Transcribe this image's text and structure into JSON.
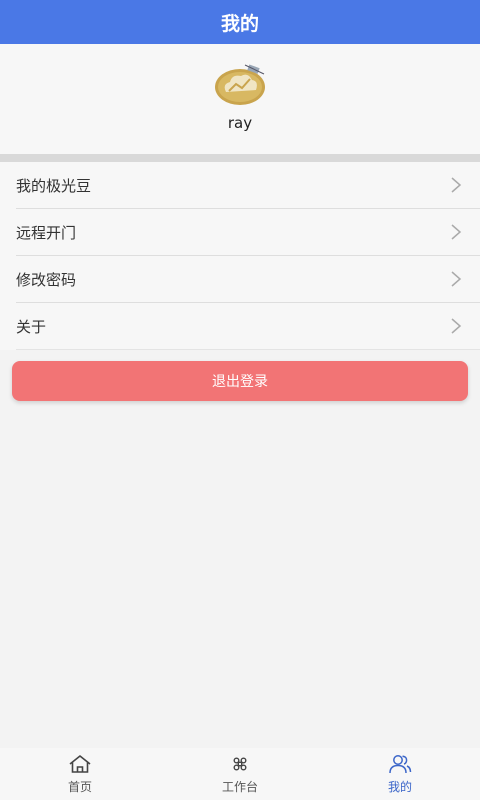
{
  "header": {
    "title": "我的"
  },
  "profile": {
    "username": "ray",
    "avatar_icon": "cloud-house-logo-icon"
  },
  "menu": {
    "items": [
      {
        "label": "我的极光豆"
      },
      {
        "label": "远程开门"
      },
      {
        "label": "修改密码"
      },
      {
        "label": "关于"
      }
    ]
  },
  "logout": {
    "label": "退出登录"
  },
  "tabbar": {
    "tabs": [
      {
        "label": "首页",
        "icon": "home-icon"
      },
      {
        "label": "工作台",
        "icon": "command-icon"
      },
      {
        "label": "我的",
        "icon": "users-icon",
        "active": true
      }
    ]
  },
  "colors": {
    "primary": "#4a78e6",
    "logout": "#f27475",
    "active_tab": "#3c66c9"
  }
}
